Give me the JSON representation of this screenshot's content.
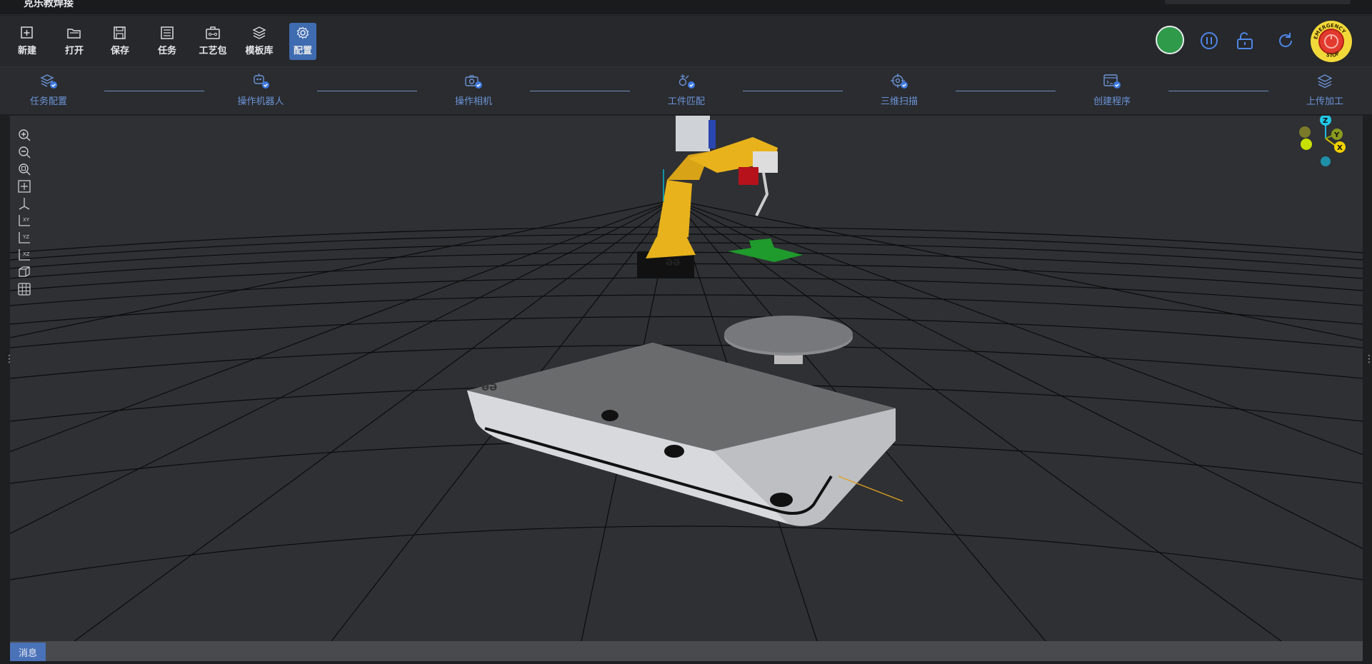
{
  "window": {
    "title": "克乐教焊接"
  },
  "toolbar": {
    "items": [
      {
        "label": "新建",
        "icon": "new-file-icon"
      },
      {
        "label": "打开",
        "icon": "open-folder-icon"
      },
      {
        "label": "保存",
        "icon": "save-icon"
      },
      {
        "label": "任务",
        "icon": "task-list-icon"
      },
      {
        "label": "工艺包",
        "icon": "process-package-icon"
      },
      {
        "label": "模板库",
        "icon": "template-library-icon"
      },
      {
        "label": "配置",
        "icon": "settings-gear-icon",
        "active": true
      }
    ],
    "right": {
      "status_color": "#2e9a4a",
      "emergency_color": "#e23a2e",
      "emergency_ring": "#f2d93a",
      "emergency_label": "EMERGENCY STOP"
    }
  },
  "steps": [
    {
      "label": "任务配置",
      "icon": "task-config-icon"
    },
    {
      "label": "操作机器人",
      "icon": "robot-icon"
    },
    {
      "label": "操作相机",
      "icon": "camera-icon"
    },
    {
      "label": "工件匹配",
      "icon": "workpiece-match-icon"
    },
    {
      "label": "三维扫描",
      "icon": "scan-3d-icon"
    },
    {
      "label": "创建程序",
      "icon": "create-program-icon"
    },
    {
      "label": "上传加工",
      "icon": "upload-icon"
    }
  ],
  "viewport": {
    "tools": [
      "zoom-in-icon",
      "zoom-out-icon",
      "zoom-fit-icon",
      "fit-all-icon",
      "axes-icon",
      "view-xy-icon",
      "view-yz-icon",
      "view-xz-icon",
      "box-view-icon",
      "grid-icon"
    ],
    "axis_labels": {
      "z": "Z",
      "y": "Y",
      "x": "X"
    },
    "robot_logo": "ƏƏ"
  },
  "statusbar": {
    "message_tab": "消息"
  },
  "colors": {
    "accent": "#3f6bb0",
    "step_text": "#6c93d6",
    "robot_yellow": "#e8b21c"
  }
}
